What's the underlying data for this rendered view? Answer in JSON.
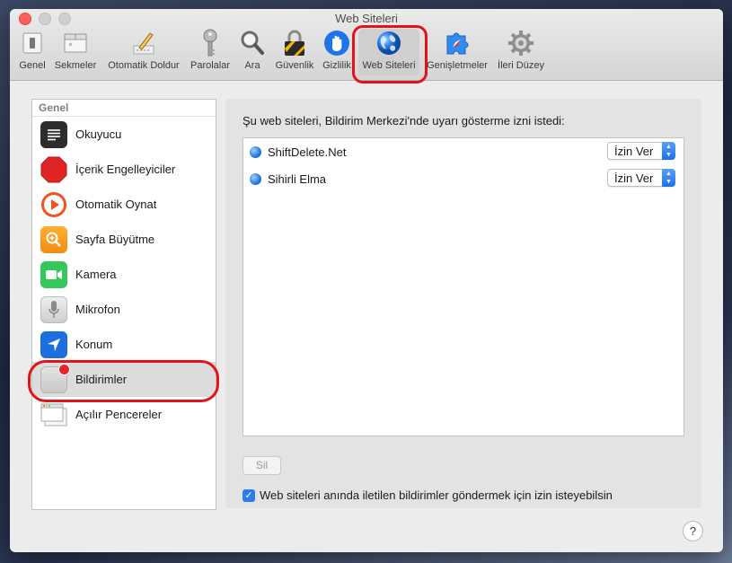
{
  "window": {
    "title": "Web Siteleri"
  },
  "toolbar": {
    "items": [
      {
        "label": "Genel",
        "icon": "switch-icon"
      },
      {
        "label": "Sekmeler",
        "icon": "tabs-icon"
      },
      {
        "label": "Otomatik Doldur",
        "icon": "pencil-icon"
      },
      {
        "label": "Parolalar",
        "icon": "key-icon"
      },
      {
        "label": "Ara",
        "icon": "magnifier-icon"
      },
      {
        "label": "Güvenlik",
        "icon": "padlock-icon"
      },
      {
        "label": "Gizlilik",
        "icon": "hand-icon"
      },
      {
        "label": "Web Siteleri",
        "icon": "globe-icon",
        "selected": true
      },
      {
        "label": "Genişletmeler",
        "icon": "puzzle-icon"
      },
      {
        "label": "İleri Düzey",
        "icon": "gear-icon"
      }
    ]
  },
  "sidebar": {
    "header": "Genel",
    "items": [
      {
        "label": "Okuyucu",
        "icon": "reader-icon"
      },
      {
        "label": "İçerik Engelleyiciler",
        "icon": "stop-sign-icon"
      },
      {
        "label": "Otomatik Oynat",
        "icon": "play-icon"
      },
      {
        "label": "Sayfa Büyütme",
        "icon": "zoom-icon"
      },
      {
        "label": "Kamera",
        "icon": "camera-icon"
      },
      {
        "label": "Mikrofon",
        "icon": "microphone-icon"
      },
      {
        "label": "Konum",
        "icon": "location-arrow-icon"
      },
      {
        "label": "Bildirimler",
        "icon": "notifications-icon",
        "selected": true
      },
      {
        "label": "Açılır Pencereler",
        "icon": "popup-windows-icon"
      }
    ]
  },
  "main": {
    "caption": "Şu web siteleri, Bildirim Merkezi'nde uyarı gösterme izni istedi:",
    "sites": [
      {
        "name": "ShiftDelete.Net",
        "permission": "İzin Ver"
      },
      {
        "name": "Sihirli Elma",
        "permission": "İzin Ver"
      }
    ],
    "remove_label": "Sil",
    "checkbox_label": "Web siteleri anında iletilen bildirimler göndermek için izin isteyebilsin",
    "checkbox_checked": true
  },
  "help": {
    "label": "?"
  },
  "colors": {
    "highlight_ring": "#e3131c",
    "accent": "#2c7cf0"
  }
}
